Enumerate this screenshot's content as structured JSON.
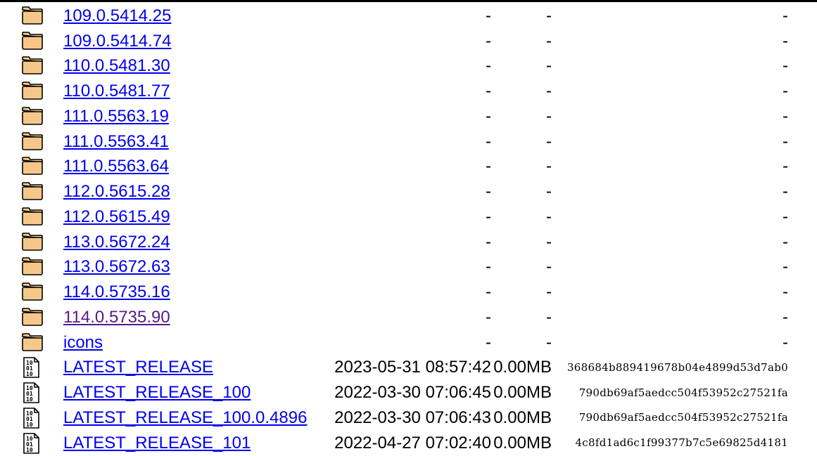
{
  "listing": {
    "rows": [
      {
        "name": "109.0.5414.25",
        "type": "folder",
        "date": "-",
        "size": "-",
        "hash": "-",
        "visited": false
      },
      {
        "name": "109.0.5414.74",
        "type": "folder",
        "date": "-",
        "size": "-",
        "hash": "-",
        "visited": false
      },
      {
        "name": "110.0.5481.30",
        "type": "folder",
        "date": "-",
        "size": "-",
        "hash": "-",
        "visited": false
      },
      {
        "name": "110.0.5481.77",
        "type": "folder",
        "date": "-",
        "size": "-",
        "hash": "-",
        "visited": false
      },
      {
        "name": "111.0.5563.19",
        "type": "folder",
        "date": "-",
        "size": "-",
        "hash": "-",
        "visited": false
      },
      {
        "name": "111.0.5563.41",
        "type": "folder",
        "date": "-",
        "size": "-",
        "hash": "-",
        "visited": false
      },
      {
        "name": "111.0.5563.64",
        "type": "folder",
        "date": "-",
        "size": "-",
        "hash": "-",
        "visited": false
      },
      {
        "name": "112.0.5615.28",
        "type": "folder",
        "date": "-",
        "size": "-",
        "hash": "-",
        "visited": false
      },
      {
        "name": "112.0.5615.49",
        "type": "folder",
        "date": "-",
        "size": "-",
        "hash": "-",
        "visited": false
      },
      {
        "name": "113.0.5672.24",
        "type": "folder",
        "date": "-",
        "size": "-",
        "hash": "-",
        "visited": false
      },
      {
        "name": "113.0.5672.63",
        "type": "folder",
        "date": "-",
        "size": "-",
        "hash": "-",
        "visited": false
      },
      {
        "name": "114.0.5735.16",
        "type": "folder",
        "date": "-",
        "size": "-",
        "hash": "-",
        "visited": false
      },
      {
        "name": "114.0.5735.90",
        "type": "folder",
        "date": "-",
        "size": "-",
        "hash": "-",
        "visited": true
      },
      {
        "name": "icons",
        "type": "folder",
        "date": "-",
        "size": "-",
        "hash": "-",
        "visited": false
      },
      {
        "name": "LATEST_RELEASE",
        "type": "binary-file",
        "date": "2023-05-31 08:57:42",
        "size": "0.00MB",
        "hash": "368684b889419678b04e4899d53d7ab0",
        "visited": false
      },
      {
        "name": "LATEST_RELEASE_100",
        "type": "binary-file",
        "date": "2022-03-30 07:06:45",
        "size": "0.00MB",
        "hash": "790db69af5aedcc504f53952c27521fa",
        "visited": false
      },
      {
        "name": "LATEST_RELEASE_100.0.4896",
        "type": "binary-file",
        "date": "2022-03-30 07:06:43",
        "size": "0.00MB",
        "hash": "790db69af5aedcc504f53952c27521fa",
        "visited": false
      },
      {
        "name": "LATEST_RELEASE_101",
        "type": "binary-file",
        "date": "2022-04-27 07:02:40",
        "size": "0.00MB",
        "hash": "4c8fd1ad6c1f99377b7c5e69825d4181",
        "visited": false
      }
    ]
  },
  "colors": {
    "link": "#0000ee",
    "visited_link": "#551a8b",
    "folder_fill": "#f5c88a",
    "folder_stroke": "#000000"
  },
  "icons": {
    "folder": "folder-icon",
    "binary-file": "binary-file-icon"
  }
}
